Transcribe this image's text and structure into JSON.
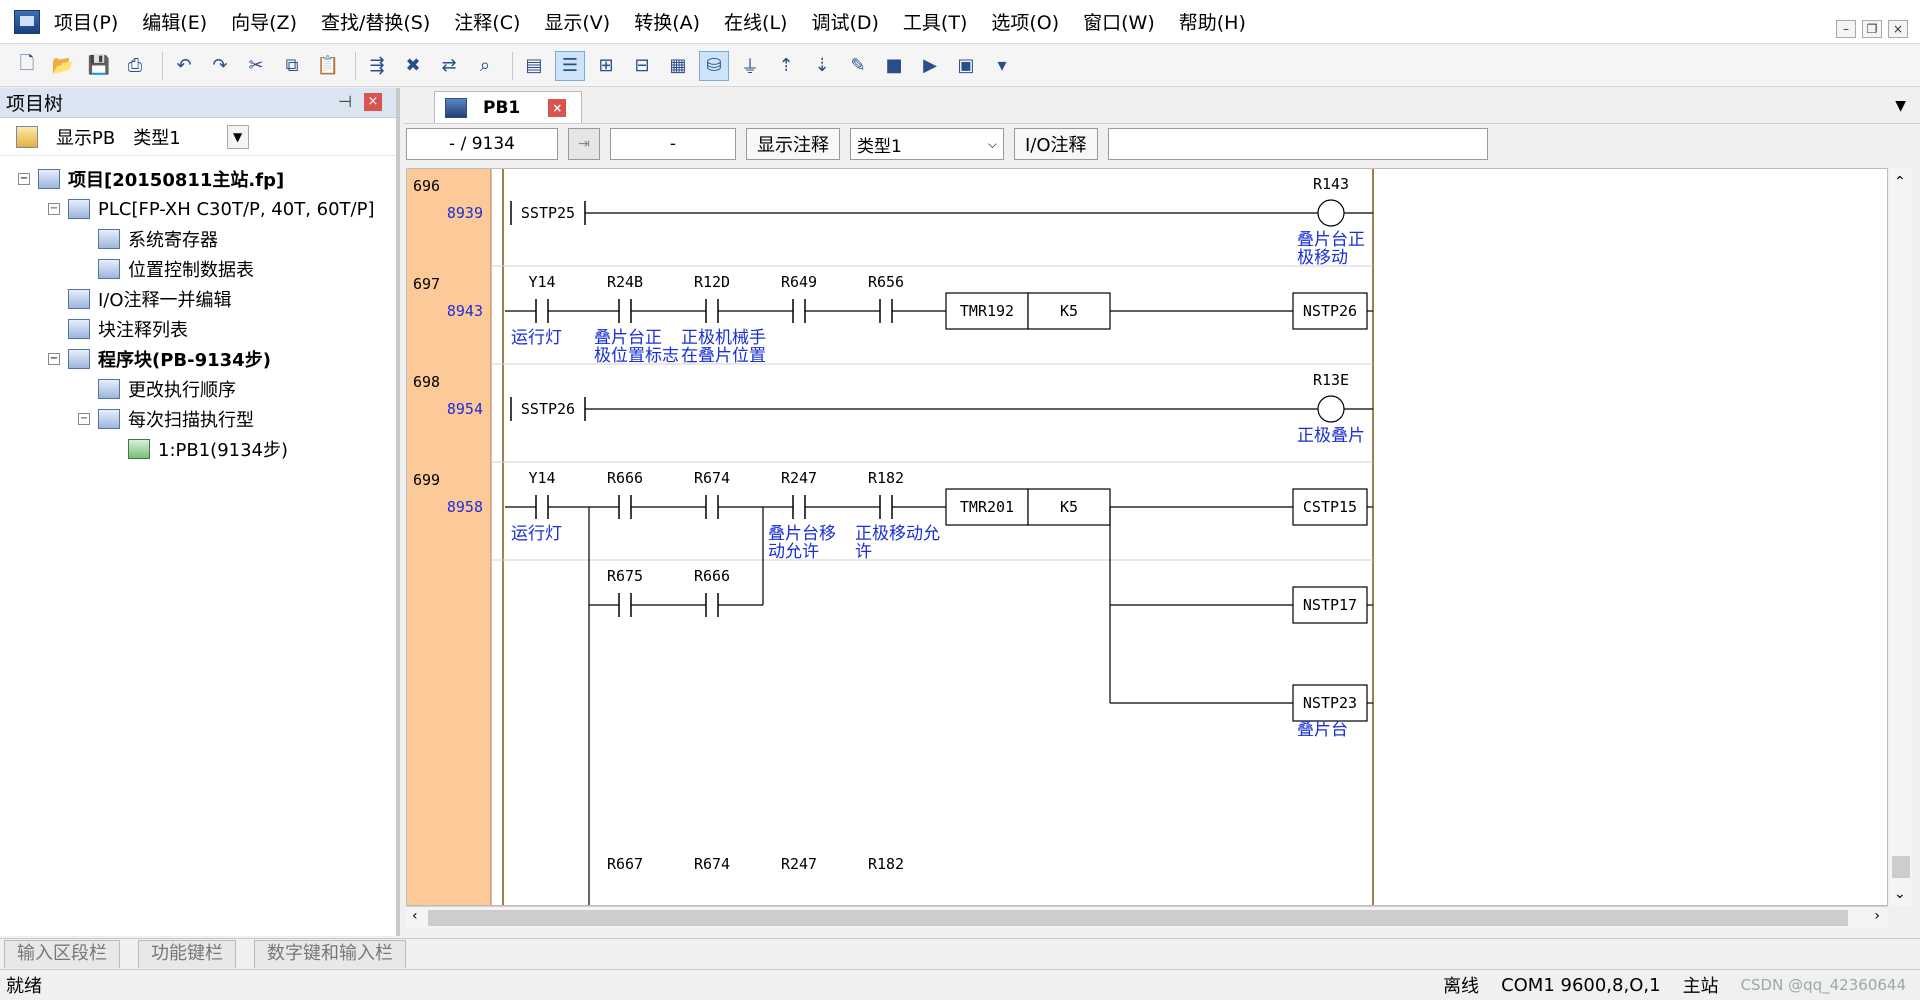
{
  "menu": [
    "项目(P)",
    "编辑(E)",
    "向导(Z)",
    "查找/替换(S)",
    "注释(C)",
    "显示(V)",
    "转换(A)",
    "在线(L)",
    "调试(D)",
    "工具(T)",
    "选项(O)",
    "窗口(W)",
    "帮助(H)"
  ],
  "window_controls": {
    "minimize": "–",
    "restore": "❐",
    "close": "×"
  },
  "toolbar_icons": [
    "new-icon",
    "open-icon",
    "save-icon",
    "print-icon",
    "undo-icon",
    "redo-icon",
    "cut-icon",
    "copy-icon",
    "paste-icon",
    "insert-row-icon",
    "delete-row-icon",
    "replace-icon",
    "find-icon",
    "compile-icon",
    "monitor-list-icon",
    "monitor-ladder-icon",
    "monitor-data-icon",
    "io-list-icon",
    "online-mode-icon",
    "connect-icon",
    "upload-icon",
    "download-icon",
    "force-icon",
    "stop-icon",
    "run-icon",
    "register-monitor-icon",
    "tool-more-icon"
  ],
  "left_panel": {
    "title": "项目树",
    "pin": "⊣",
    "close": "×",
    "show_pb": "显示PB",
    "type_label": "类型1",
    "tree": [
      {
        "level": 0,
        "toggle": "−",
        "label": "项目[20150811主站.fp]",
        "bold": true
      },
      {
        "level": 1,
        "toggle": "−",
        "label": "PLC[FP-XH C30T/P, 40T, 60T/P]",
        "bold": false
      },
      {
        "level": 2,
        "toggle": "",
        "label": "系统寄存器",
        "bold": false
      },
      {
        "level": 2,
        "toggle": "",
        "label": "位置控制数据表",
        "bold": false
      },
      {
        "level": 1,
        "toggle": "",
        "label": "I/O注释一并编辑",
        "bold": false
      },
      {
        "level": 1,
        "toggle": "",
        "label": "块注释列表",
        "bold": false
      },
      {
        "level": 1,
        "toggle": "−",
        "label": "程序块(PB-9134步)",
        "bold": true
      },
      {
        "level": 2,
        "toggle": "",
        "label": "更改执行顺序",
        "bold": false
      },
      {
        "level": 2,
        "toggle": "−",
        "label": "每次扫描执行型",
        "bold": false
      },
      {
        "level": 3,
        "toggle": "",
        "label": "1:PB1(9134步)",
        "bold": false
      }
    ]
  },
  "doc_tab": {
    "label": "PB1",
    "close": "×"
  },
  "editor_toolbar": {
    "step_field": "- /  9134",
    "address_field": "-",
    "show_comment": "显示注释",
    "type_select": "类型1",
    "io_comment": "I/O注释",
    "io_comment_value": ""
  },
  "ladder": {
    "rungs": [
      {
        "number": "696",
        "step": "8939",
        "elements": [
          {
            "kind": "start",
            "label": "SSTP25"
          },
          {
            "kind": "coil",
            "label": "R143",
            "comment": [
              "叠片台正",
              "极移动"
            ]
          }
        ]
      },
      {
        "number": "697",
        "step": "8943",
        "contacts": [
          {
            "label": "Y14",
            "comment": [
              "运行灯"
            ]
          },
          {
            "label": "R24B",
            "comment": [
              "叠片台正",
              "极位置标志"
            ]
          },
          {
            "label": "R12D",
            "comment": [
              "正极机械手",
              "在叠片位置"
            ]
          },
          {
            "label": "R649",
            "comment": []
          },
          {
            "label": "R656",
            "comment": []
          }
        ],
        "timer": {
          "name": "TMR192",
          "value": "K5"
        },
        "output": "NSTP26"
      },
      {
        "number": "698",
        "step": "8954",
        "elements": [
          {
            "kind": "start",
            "label": "SSTP26"
          },
          {
            "kind": "coil",
            "label": "R13E",
            "comment": [
              "正极叠片"
            ]
          }
        ]
      },
      {
        "number": "699",
        "step": "8958",
        "contacts": [
          {
            "label": "Y14",
            "comment": [
              "运行灯"
            ]
          },
          {
            "label": "R666",
            "comment": []
          },
          {
            "label": "R674",
            "comment": []
          },
          {
            "label": "R247",
            "comment": [
              "叠片台移",
              "动允许"
            ]
          },
          {
            "label": "R182",
            "comment": [
              "正极移动允",
              "许"
            ]
          }
        ],
        "branch_contacts": [
          {
            "label": "R675"
          },
          {
            "label": "R666"
          }
        ],
        "timer": {
          "name": "TMR201",
          "value": "K5"
        },
        "outputs": [
          {
            "label": "CSTP15",
            "comment": []
          },
          {
            "label": "NSTP17",
            "comment": []
          },
          {
            "label": "NSTP23",
            "comment": [
              "叠片台"
            ]
          }
        ],
        "next_row_labels": [
          "R667",
          "R674",
          "R247",
          "R182"
        ]
      }
    ]
  },
  "bottom_tabs": [
    "输入区段栏",
    "功能键栏",
    "数字键和输入栏"
  ],
  "status": {
    "ready": "就绪",
    "mode": "离线",
    "port": "COM1 9600,8,O,1",
    "station": "主站",
    "watermark": "CSDN @qq_42360644"
  }
}
